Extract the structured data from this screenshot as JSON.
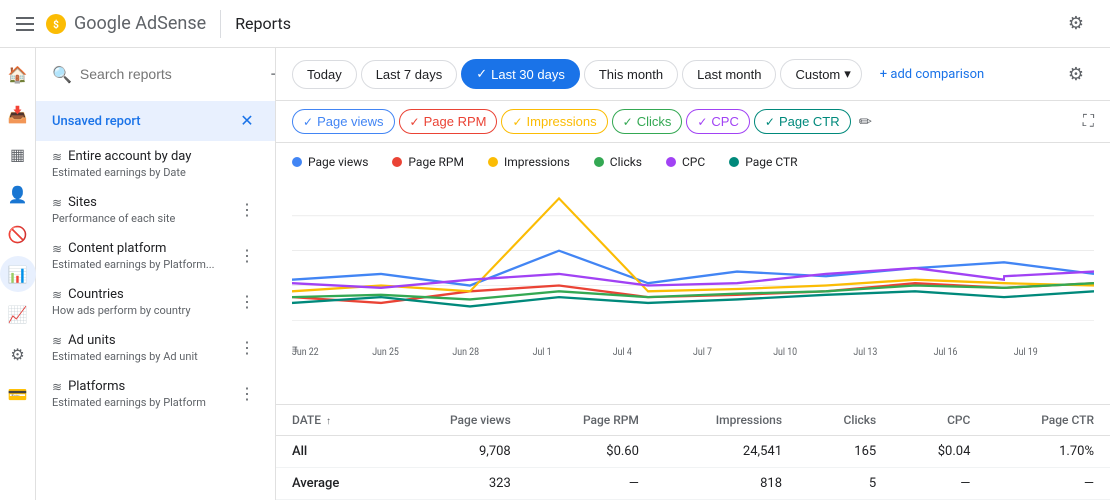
{
  "topbar": {
    "title": "Reports",
    "settings_label": "Settings"
  },
  "logo": {
    "product_name": "Google AdSense"
  },
  "date_filters": {
    "today": "Today",
    "last7": "Last 7 days",
    "last30": "Last 30 days",
    "this_month": "This month",
    "last_month": "Last month",
    "custom": "Custom",
    "add_comparison": "+ add comparison"
  },
  "metric_tabs": [
    {
      "id": "page_views",
      "label": "Page views",
      "color_class": "metric-tab-blue",
      "dot_color": "#4285f4"
    },
    {
      "id": "page_rpm",
      "label": "Page RPM",
      "color_class": "metric-tab-red",
      "dot_color": "#ea4335"
    },
    {
      "id": "impressions",
      "label": "Impressions",
      "color_class": "metric-tab-yellow",
      "dot_color": "#fbbc04"
    },
    {
      "id": "clicks",
      "label": "Clicks",
      "color_class": "metric-tab-green",
      "dot_color": "#34a853"
    },
    {
      "id": "cpc",
      "label": "CPC",
      "color_class": "metric-tab-purple",
      "dot_color": "#a142f4"
    },
    {
      "id": "page_ctr",
      "label": "Page CTR",
      "color_class": "metric-tab-teal",
      "dot_color": "#00897b"
    }
  ],
  "chart_legend": [
    {
      "label": "Page views",
      "color": "#4285f4"
    },
    {
      "label": "Page RPM",
      "color": "#ea4335"
    },
    {
      "label": "Impressions",
      "color": "#fbbc04"
    },
    {
      "label": "Clicks",
      "color": "#34a853"
    },
    {
      "label": "CPC",
      "color": "#a142f4"
    },
    {
      "label": "Page CTR",
      "color": "#00897b"
    }
  ],
  "chart_x_labels": [
    "Jun 22",
    "Jun 25",
    "Jun 28",
    "Jul 1",
    "Jul 4",
    "Jul 7",
    "Jul 10",
    "Jul 13",
    "Jul 16",
    "Jul 19"
  ],
  "sidebar": {
    "search_placeholder": "Search reports",
    "active_item": "Unsaved report",
    "items": [
      {
        "title": "Entire account by day",
        "subtitle": "Estimated earnings by Date"
      },
      {
        "title": "Sites",
        "subtitle": "Performance of each site"
      },
      {
        "title": "Content platform",
        "subtitle": "Estimated earnings by Platform..."
      },
      {
        "title": "Countries",
        "subtitle": "How ads perform by country"
      },
      {
        "title": "Ad units",
        "subtitle": "Estimated earnings by Ad unit"
      },
      {
        "title": "Platforms",
        "subtitle": "Estimated earnings by Platform"
      }
    ]
  },
  "table": {
    "headers": [
      "DATE",
      "Page views",
      "Page RPM",
      "Impressions",
      "Clicks",
      "CPC",
      "Page CTR"
    ],
    "rows": [
      {
        "date": "All",
        "page_views": "9,708",
        "page_rpm": "$0.60",
        "impressions": "24,541",
        "clicks": "165",
        "cpc": "$0.04",
        "page_ctr": "1.70%"
      },
      {
        "date": "Average",
        "page_views": "323",
        "page_rpm": "—",
        "impressions": "818",
        "clicks": "5",
        "cpc": "—",
        "page_ctr": "—"
      }
    ]
  }
}
